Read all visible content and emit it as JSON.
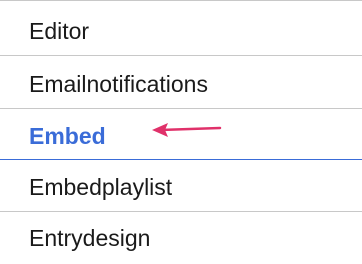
{
  "list": {
    "items": [
      {
        "label": "Editor",
        "active": false
      },
      {
        "label": "Emailnotifications",
        "active": false
      },
      {
        "label": "Embed",
        "active": true
      },
      {
        "label": "Embedplaylist",
        "active": false
      },
      {
        "label": "Entrydesign",
        "active": false
      }
    ]
  },
  "colors": {
    "active_text": "#3a6cd8",
    "divider": "#c8c8c8",
    "active_divider": "#3a6cd8",
    "arrow": "#e0316a"
  },
  "annotation": {
    "icon": "arrow-left-icon"
  }
}
